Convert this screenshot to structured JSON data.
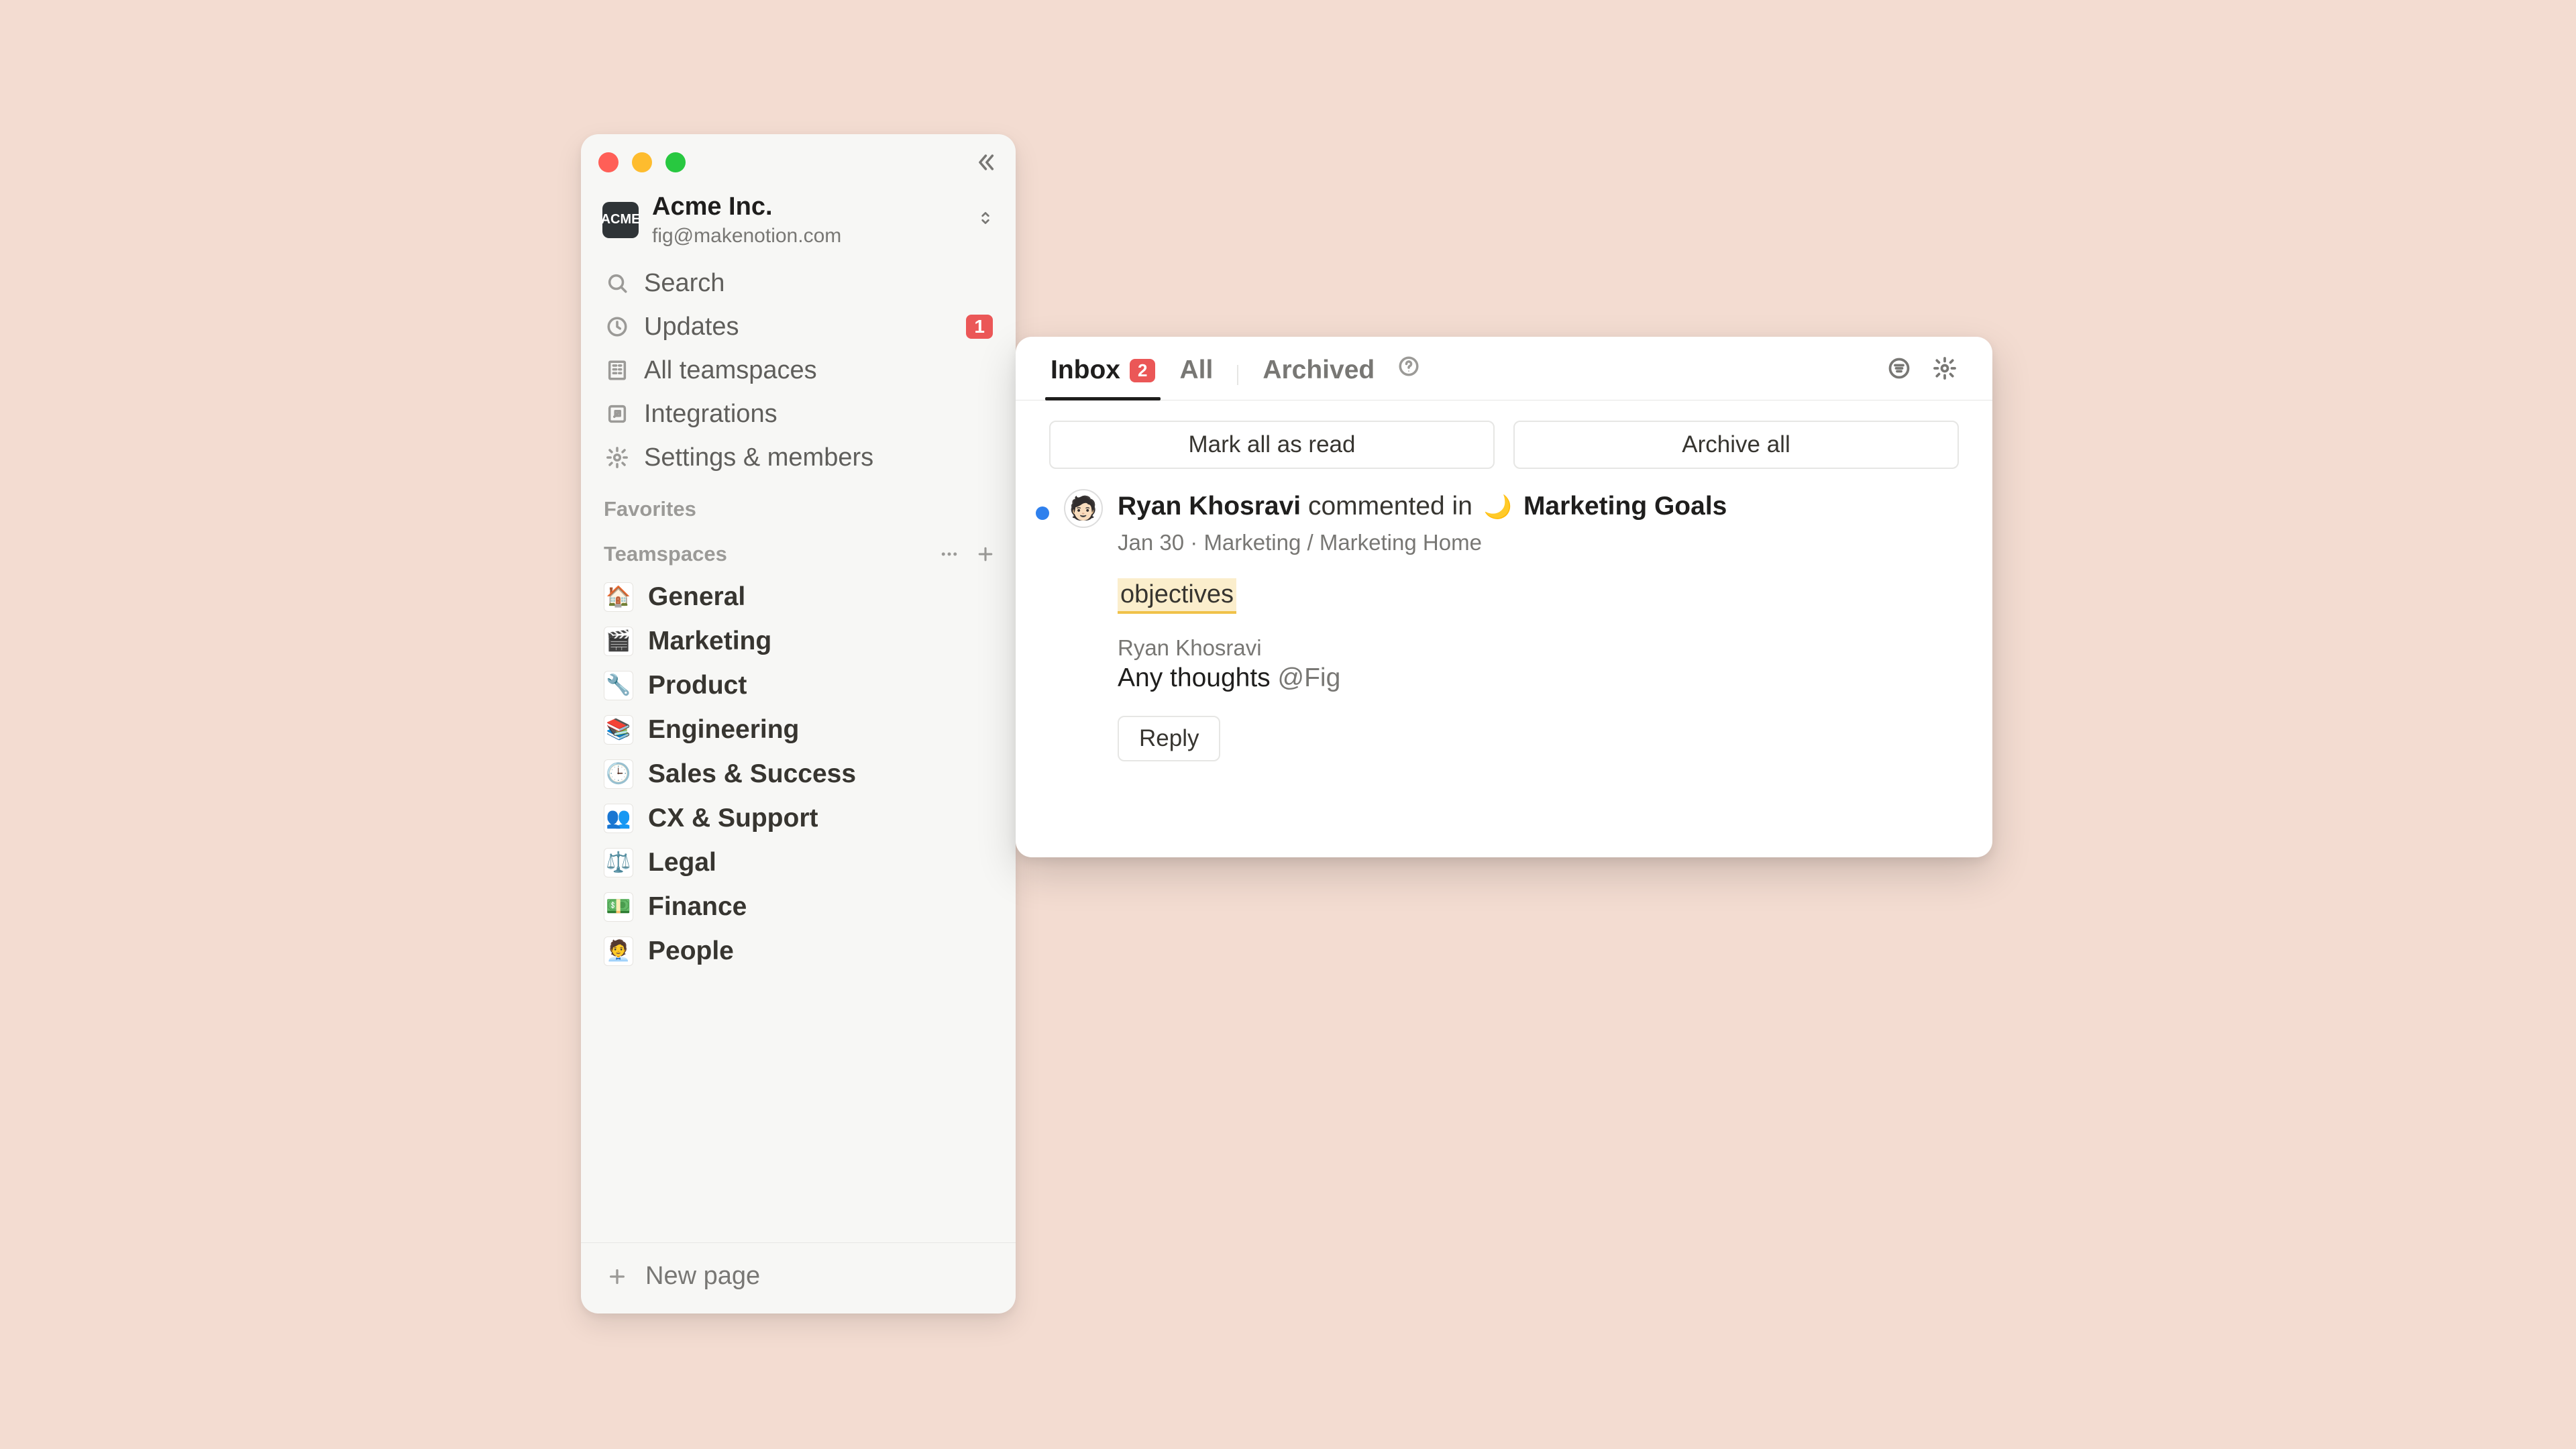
{
  "workspace": {
    "badge_text": "ACME",
    "name": "Acme Inc.",
    "email": "fig@makenotion.com"
  },
  "sidebar": {
    "nav": [
      {
        "icon": "search-icon",
        "label": "Search"
      },
      {
        "icon": "clock-icon",
        "label": "Updates",
        "badge": "1"
      },
      {
        "icon": "teamspaces-icon",
        "label": "All teamspaces"
      },
      {
        "icon": "arrow-out-icon",
        "label": "Integrations"
      },
      {
        "icon": "gear-icon",
        "label": "Settings & members"
      }
    ],
    "favorites_label": "Favorites",
    "teamspaces_label": "Teamspaces",
    "teamspaces": [
      {
        "emoji": "🏠",
        "label": "General"
      },
      {
        "emoji": "🎬",
        "label": "Marketing"
      },
      {
        "emoji": "🔧",
        "label": "Product"
      },
      {
        "emoji": "📚",
        "label": "Engineering"
      },
      {
        "emoji": "🕒",
        "label": "Sales & Success"
      },
      {
        "emoji": "👥",
        "label": "CX & Support"
      },
      {
        "emoji": "⚖️",
        "label": "Legal"
      },
      {
        "emoji": "💵",
        "label": "Finance"
      },
      {
        "emoji": "🧑‍💼",
        "label": "People"
      }
    ],
    "new_page_label": "New page"
  },
  "updates": {
    "tabs": {
      "inbox": {
        "label": "Inbox",
        "badge": "2"
      },
      "all": {
        "label": "All"
      },
      "archived": {
        "label": "Archived"
      }
    },
    "mark_all_label": "Mark all as read",
    "archive_all_label": "Archive all",
    "notification": {
      "actor": "Ryan Khosravi",
      "action": "commented in",
      "page_emoji": "🌙",
      "page_name": "Marketing Goals",
      "date": "Jan 30",
      "breadcrumb": "Marketing / Marketing Home",
      "excerpt": "objectives",
      "commenter": "Ryan Khosravi",
      "comment_text": "Any thoughts ",
      "mention": "@Fig",
      "reply_label": "Reply"
    }
  }
}
